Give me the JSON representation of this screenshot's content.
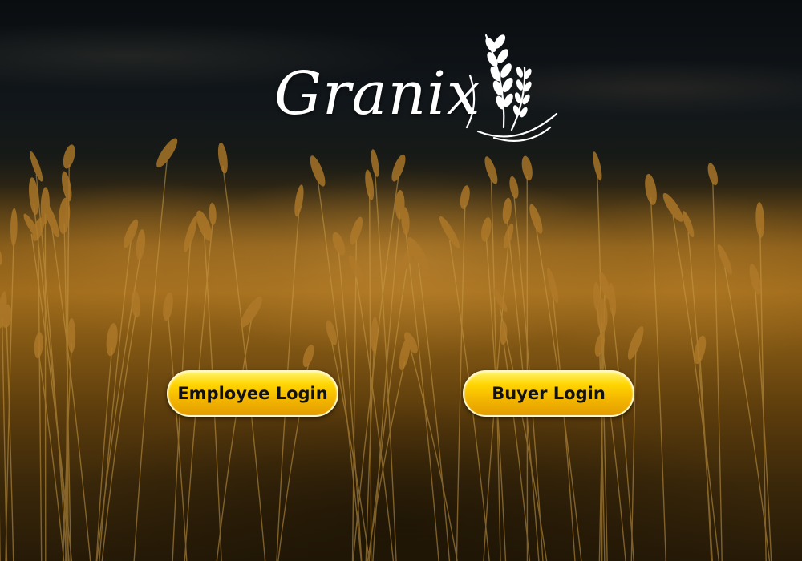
{
  "brand": {
    "name": "Granix",
    "logo_color": "#ffffff"
  },
  "actions": {
    "employee_login_label": "Employee Login",
    "buyer_login_label": "Buyer Login"
  },
  "colors": {
    "button_gradient_top": "#fff36a",
    "button_gradient_bottom": "#e39d00",
    "button_text": "#111111"
  },
  "background": {
    "scene": "wheat-field-at-dusk"
  }
}
